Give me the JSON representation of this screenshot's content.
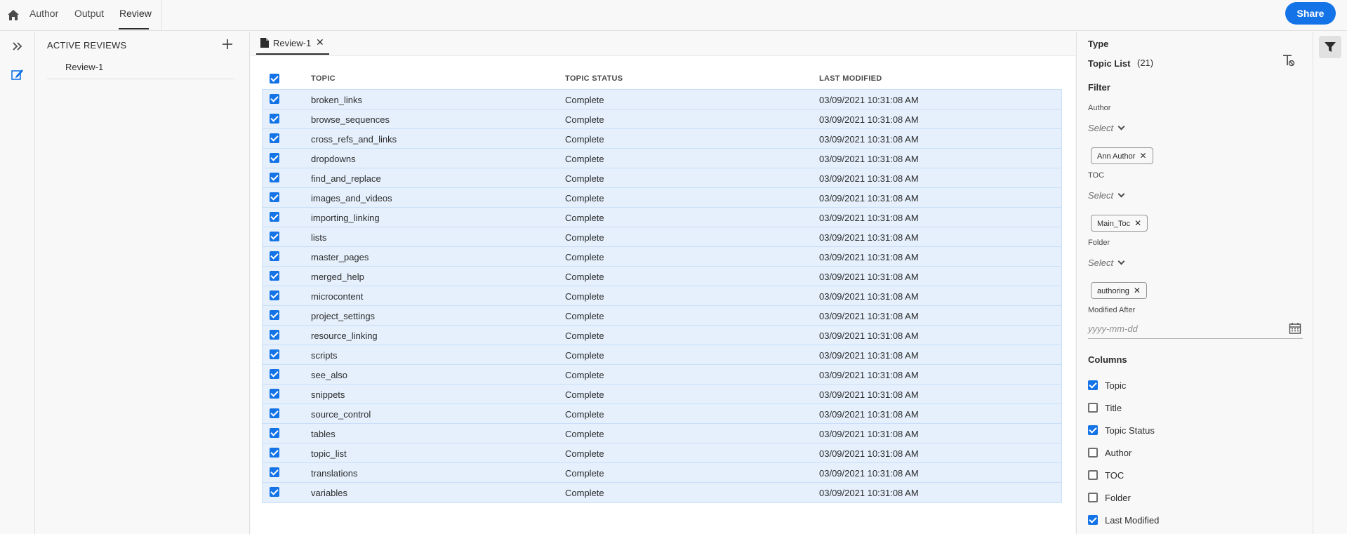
{
  "topbar": {
    "tabs": [
      {
        "label": "Author"
      },
      {
        "label": "Output"
      },
      {
        "label": "Review"
      }
    ],
    "share_label": "Share"
  },
  "reviews_panel": {
    "title": "ACTIVE REVIEWS",
    "items": [
      {
        "label": "Review-1"
      }
    ]
  },
  "doc_tab": {
    "label": "Review-1",
    "close": "✕"
  },
  "table": {
    "headers": {
      "topic": "TOPIC",
      "status": "TOPIC STATUS",
      "modified": "LAST MODIFIED"
    },
    "rows": [
      {
        "topic": "broken_links",
        "status": "Complete",
        "modified": "03/09/2021 10:31:08 AM"
      },
      {
        "topic": "browse_sequences",
        "status": "Complete",
        "modified": "03/09/2021 10:31:08 AM"
      },
      {
        "topic": "cross_refs_and_links",
        "status": "Complete",
        "modified": "03/09/2021 10:31:08 AM"
      },
      {
        "topic": "dropdowns",
        "status": "Complete",
        "modified": "03/09/2021 10:31:08 AM"
      },
      {
        "topic": "find_and_replace",
        "status": "Complete",
        "modified": "03/09/2021 10:31:08 AM"
      },
      {
        "topic": "images_and_videos",
        "status": "Complete",
        "modified": "03/09/2021 10:31:08 AM"
      },
      {
        "topic": "importing_linking",
        "status": "Complete",
        "modified": "03/09/2021 10:31:08 AM"
      },
      {
        "topic": "lists",
        "status": "Complete",
        "modified": "03/09/2021 10:31:08 AM"
      },
      {
        "topic": "master_pages",
        "status": "Complete",
        "modified": "03/09/2021 10:31:08 AM"
      },
      {
        "topic": "merged_help",
        "status": "Complete",
        "modified": "03/09/2021 10:31:08 AM"
      },
      {
        "topic": "microcontent",
        "status": "Complete",
        "modified": "03/09/2021 10:31:08 AM"
      },
      {
        "topic": "project_settings",
        "status": "Complete",
        "modified": "03/09/2021 10:31:08 AM"
      },
      {
        "topic": "resource_linking",
        "status": "Complete",
        "modified": "03/09/2021 10:31:08 AM"
      },
      {
        "topic": "scripts",
        "status": "Complete",
        "modified": "03/09/2021 10:31:08 AM"
      },
      {
        "topic": "see_also",
        "status": "Complete",
        "modified": "03/09/2021 10:31:08 AM"
      },
      {
        "topic": "snippets",
        "status": "Complete",
        "modified": "03/09/2021 10:31:08 AM"
      },
      {
        "topic": "source_control",
        "status": "Complete",
        "modified": "03/09/2021 10:31:08 AM"
      },
      {
        "topic": "tables",
        "status": "Complete",
        "modified": "03/09/2021 10:31:08 AM"
      },
      {
        "topic": "topic_list",
        "status": "Complete",
        "modified": "03/09/2021 10:31:08 AM"
      },
      {
        "topic": "translations",
        "status": "Complete",
        "modified": "03/09/2021 10:31:08 AM"
      },
      {
        "topic": "variables",
        "status": "Complete",
        "modified": "03/09/2021 10:31:08 AM"
      }
    ]
  },
  "right_panel": {
    "type_heading": "Type",
    "type_value": "Topic List",
    "type_count": "(21)",
    "filter_heading": "Filter",
    "author_label": "Author",
    "author_select": "Select",
    "author_tag": "Ann Author",
    "toc_label": "TOC",
    "toc_select": "Select",
    "toc_tag": "Main_Toc",
    "folder_label": "Folder",
    "folder_select": "Select",
    "folder_tag": "authoring",
    "modified_after_label": "Modified After",
    "date_placeholder": "yyyy-mm-dd",
    "columns_heading": "Columns",
    "columns": [
      {
        "label": "Topic",
        "checked": true
      },
      {
        "label": "Title",
        "checked": false
      },
      {
        "label": "Topic Status",
        "checked": true
      },
      {
        "label": "Author",
        "checked": false
      },
      {
        "label": "TOC",
        "checked": false
      },
      {
        "label": "Folder",
        "checked": false
      },
      {
        "label": "Last Modified",
        "checked": true
      }
    ]
  },
  "icons": {
    "home": "home-icon",
    "expand": "double-chevron-right-icon",
    "review": "review-edit-icon",
    "add": "plus-icon",
    "doc": "document-icon",
    "calendar": "calendar-icon",
    "clear_filter": "clear-format-icon",
    "filter": "filter-icon"
  },
  "accent_color": "#1473e6"
}
